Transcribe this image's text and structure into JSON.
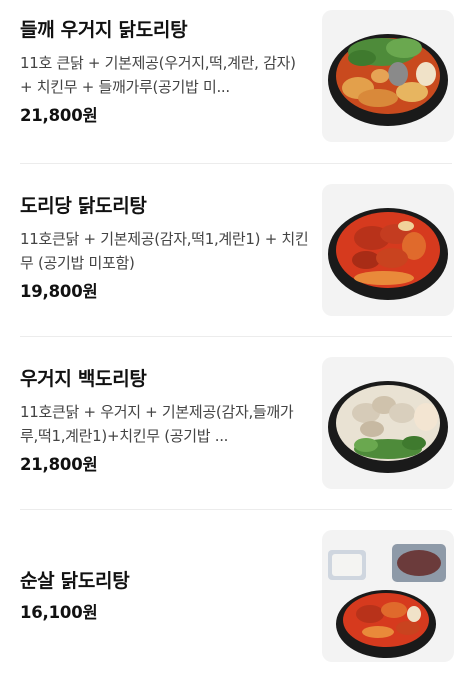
{
  "menu": {
    "items": [
      {
        "name": "들깨 우거지 닭도리탕",
        "description": "11호 큰닭 + 기본제공(우거지,떡,계란, 감자) + 치킨무 + 들깨가루(공기밥 미...",
        "price": "21,800원",
        "image_icon": "dish-photo"
      },
      {
        "name": "도리당 닭도리탕",
        "description": "11호큰닭 + 기본제공(감자,떡1,계란1) + 치킨무 (공기밥 미포함)",
        "price": "19,800원",
        "image_icon": "dish-photo"
      },
      {
        "name": "우거지 백도리탕",
        "description": "11호큰닭 + 우거지 + 기본제공(감자,들깨가루,떡1,계란1)+치킨무 (공기밥 ...",
        "price": "21,800원",
        "image_icon": "dish-photo"
      },
      {
        "name": "순살 닭도리탕",
        "description": "",
        "price": "16,100원",
        "image_icon": "dish-photo"
      }
    ]
  },
  "colors": {
    "divider": "#ececec",
    "thumb_bg": "#f3f3f3",
    "pot": "#1a1a1a",
    "red_stew": "#d63a1e",
    "white_stew": "#e9e2d3",
    "greens": "#4e8b3a"
  }
}
